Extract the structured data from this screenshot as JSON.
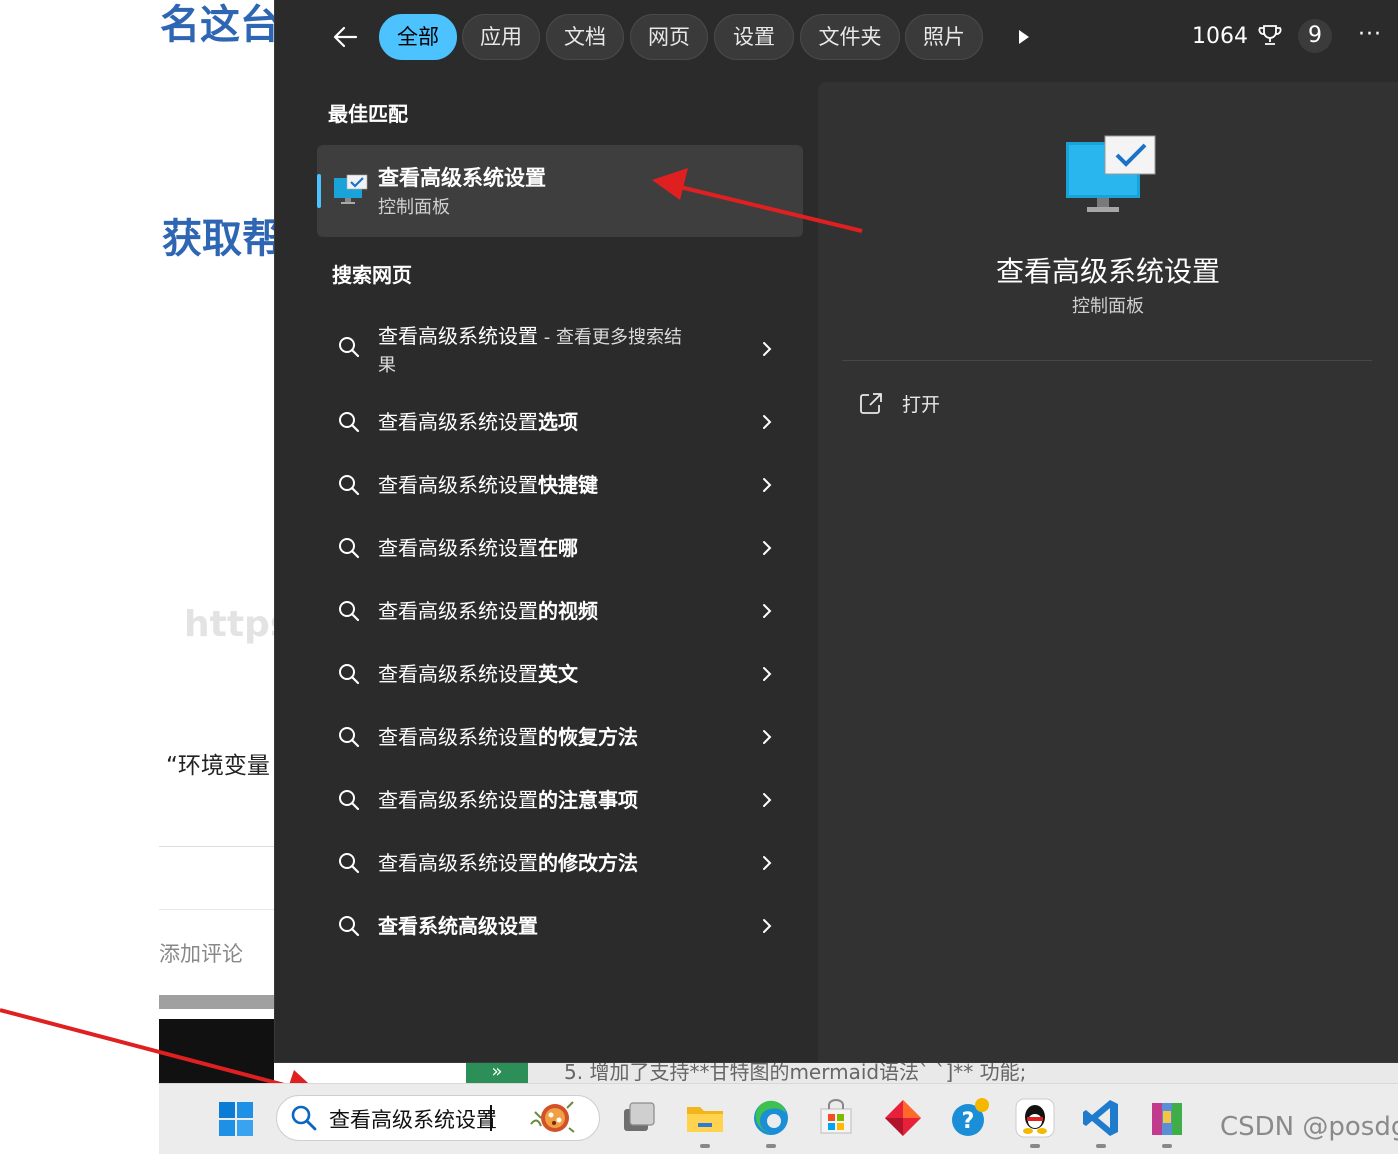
{
  "background": {
    "fragment_top": "名这台",
    "fragment_heading": "获取帮",
    "fragment_faint": "https",
    "fragment_quote": "“环境变量",
    "fragment_comment": "添加评论",
    "fragment_strip": "5. 增加了支持**甘特图的mermaid语法` `]** 功能;"
  },
  "search_panel": {
    "filters": [
      {
        "label": "全部",
        "active": true
      },
      {
        "label": "应用",
        "active": false
      },
      {
        "label": "文档",
        "active": false
      },
      {
        "label": "网页",
        "active": false
      },
      {
        "label": "设置",
        "active": false
      },
      {
        "label": "文件夹",
        "active": false
      },
      {
        "label": "照片",
        "active": false
      }
    ],
    "points": "1064",
    "badge": "9",
    "more": "···",
    "best_match_header": "最佳匹配",
    "best_match": {
      "title": "查看高级系统设置",
      "subtitle": "控制面板",
      "icon": "computer-checkmark-icon"
    },
    "web_header": "搜索网页",
    "web_results": [
      {
        "prefix": "查看高级系统设置",
        "bold": "",
        "suffix": " - 查看更多搜索结",
        "line2": "果"
      },
      {
        "prefix": "查看高级系统设置",
        "bold": "选项",
        "suffix": "",
        "line2": ""
      },
      {
        "prefix": "查看高级系统设置",
        "bold": "快捷键",
        "suffix": "",
        "line2": ""
      },
      {
        "prefix": "查看高级系统设置",
        "bold": "在哪",
        "suffix": "",
        "line2": ""
      },
      {
        "prefix": "查看高级系统设置",
        "bold": "的视频",
        "suffix": "",
        "line2": ""
      },
      {
        "prefix": "查看高级系统设置",
        "bold": "英文",
        "suffix": "",
        "line2": ""
      },
      {
        "prefix": "查看高级系统设置",
        "bold": "的恢复方法",
        "suffix": "",
        "line2": ""
      },
      {
        "prefix": "查看高级系统设置",
        "bold": "的注意事项",
        "suffix": "",
        "line2": ""
      },
      {
        "prefix": "查看高级系统设置",
        "bold": "的修改方法",
        "suffix": "",
        "line2": ""
      },
      {
        "prefix": "",
        "bold": "查看系统高级设置",
        "suffix": "",
        "line2": ""
      }
    ],
    "preview": {
      "title": "查看高级系统设置",
      "subtitle": "控制面板",
      "open_label": "打开"
    }
  },
  "taskbar": {
    "search_value": "查看高级系统设置",
    "apps": [
      "task-view-icon",
      "file-explorer-icon",
      "edge-icon",
      "microsoft-store-icon",
      "app-diamond-icon",
      "help-icon",
      "qq-icon",
      "vscode-icon",
      "winrar-icon"
    ]
  },
  "watermark": "CSDN @posdg",
  "colors": {
    "accent": "#4cc2ff",
    "panel": "#2b2b2b",
    "preview": "#323232",
    "arrow": "#e02020"
  }
}
